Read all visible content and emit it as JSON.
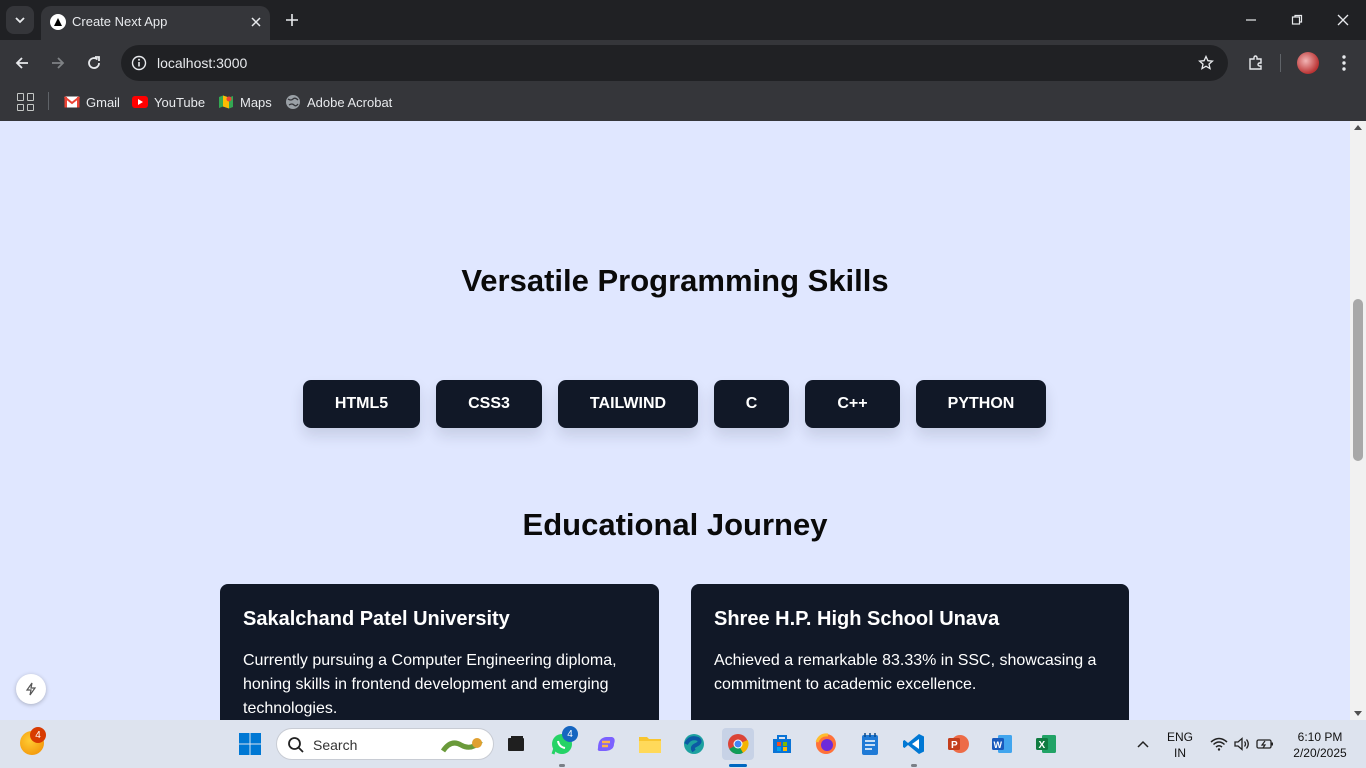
{
  "browser": {
    "tab_title": "Create Next App",
    "url": "localhost:3000",
    "bookmarks": [
      {
        "label": "Gmail",
        "icon": "gmail-icon"
      },
      {
        "label": "YouTube",
        "icon": "youtube-icon"
      },
      {
        "label": "Maps",
        "icon": "maps-icon"
      },
      {
        "label": "Adobe Acrobat",
        "icon": "globe-icon"
      }
    ]
  },
  "page": {
    "skills_title": "Versatile Programming Skills",
    "skills": [
      "HTML5",
      "CSS3",
      "TAILWIND",
      "C",
      "C++",
      "PYTHON"
    ],
    "education_title": "Educational Journey",
    "education": [
      {
        "title": "Sakalchand Patel University",
        "text": "Currently pursuing a Computer Engineering diploma, honing skills in frontend development and emerging technologies."
      },
      {
        "title": "Shree H.P. High School Unava",
        "text": "Achieved a remarkable 83.33% in SSC, showcasing a commitment to academic excellence."
      }
    ]
  },
  "taskbar": {
    "search_placeholder": "Search",
    "weather_badge": "4",
    "whatsapp_badge": "4",
    "lang_line1": "ENG",
    "lang_line2": "IN",
    "time": "6:10 PM",
    "date": "2/20/2025"
  },
  "colors": {
    "page_bg": "#e0e7ff",
    "card_bg": "#111827",
    "chrome_dark": "#202124",
    "chrome_toolbar": "#35363a"
  }
}
